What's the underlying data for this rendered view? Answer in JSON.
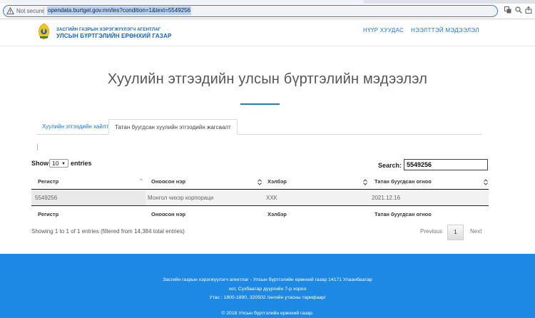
{
  "browser": {
    "security_label": "Not secure",
    "url": "opendata.burtgel.gov.mn/les?condition=1&text=5549256"
  },
  "header": {
    "org_line1": "ЗАСГИЙН ГАЗРЫН ХЭРЭГЖҮҮЛЭГЧ АГЕНТЛАГ",
    "org_line2": "УЛСЫН БҮРТГЭЛИЙН ЕРӨНХИЙ ГАЗАР",
    "nav_home": "НҮҮР ХУУДАС",
    "nav_info": "НЭЭЛТТЭЙ МЭДЭЭЛЭЛ"
  },
  "main": {
    "title": "Хуулийн этгээдийн улсын бүртгэлийн мэдээлэл",
    "tabs": [
      {
        "label": "Хуулийн этгээдийн хайлт"
      },
      {
        "label": "Татан буугдсан хуулийн этгээдийн жагсаалт"
      }
    ],
    "length": {
      "show": "Show",
      "value": "10",
      "entries": "entries"
    },
    "search": {
      "label": "Search:",
      "value": "5549256"
    }
  },
  "table": {
    "columns": [
      "Регистр",
      "Оноосон нэр",
      "Хэлбэр",
      "Татан буугдсан огноо"
    ],
    "rows": [
      [
        "5549256",
        "Монгол чихэр корпораци",
        "ХХК",
        "2021.12.16"
      ]
    ]
  },
  "pagination": {
    "info": "Showing 1 to 1 of 1 entries (filtered from 14,384 total entries)",
    "previous": "Previous",
    "current": "1",
    "next": "Next"
  },
  "footer": {
    "lines": [
      "Засгийн газрын хэрэгжүүлэгч агентлаг - Улсын бүртгэлийн ерөнхий газар 14171 Улаанбаатар",
      "хот, Сүхбаатар дүүргийн 7-р хороо",
      "Утас : 1800-1890, 320502 /энгийн утасны тарифаар/",
      "© 2018 Улсын бүртгэлийн ерөнхий газар."
    ]
  },
  "colors": {
    "accent": "#1976d2",
    "footer_bg": "#1e88e5"
  },
  "icons": [
    "warning-icon",
    "translate-icon",
    "zoom-icon",
    "share-icon",
    "bookmark-star-icon",
    "emblem-logo",
    "sort-arrows-icon"
  ]
}
